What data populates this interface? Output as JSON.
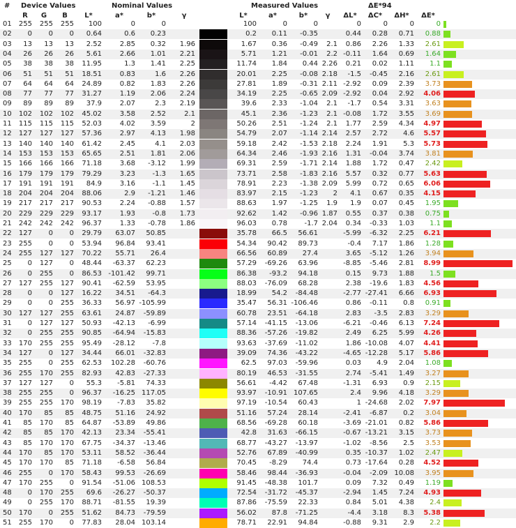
{
  "headers": {
    "group": {
      "num": "#",
      "device": "Device Values",
      "nominal": "Nominal Values",
      "measured": "Measured Values",
      "de94": "ΔE*94"
    },
    "columns": {
      "R": "R",
      "G": "G",
      "B": "B",
      "nL": "L*",
      "na": "a*",
      "nb": "b*",
      "ng": "γ",
      "mL": "L*",
      "ma": "a*",
      "mb": "b*",
      "mg": "γ",
      "dL": "ΔL*",
      "dC": "ΔC*",
      "dH": "ΔH*",
      "dE": "ΔE*"
    }
  },
  "colors": {
    "green_bar": "#7de020",
    "yellow_bar": "#c8f020",
    "orange_bar": "#e8921e",
    "red_bar": "#ee2222"
  },
  "rows": [
    {
      "n": "01",
      "R": "255",
      "G": "255",
      "B": "255",
      "nL": "100",
      "na": "0",
      "nb": "0",
      "ng": "",
      "mL": "100",
      "ma": "0",
      "mb": "0",
      "mg": "",
      "dL": "0",
      "dC": "0",
      "dH": "0",
      "dE": "0",
      "nom": "#ffffff",
      "meas": "#ffffff"
    },
    {
      "n": "02",
      "R": "0",
      "G": "0",
      "B": "0",
      "nL": "0.64",
      "na": "0.6",
      "nb": "0.23",
      "ng": "",
      "mL": "0.2",
      "ma": "0.11",
      "mb": "-0.35",
      "mg": "",
      "dL": "0.44",
      "dC": "0.28",
      "dH": "0.71",
      "dE": "0.88",
      "nom": "#020202",
      "meas": "#000000"
    },
    {
      "n": "03",
      "R": "13",
      "G": "13",
      "B": "13",
      "nL": "2.52",
      "na": "2.85",
      "nb": "0.32",
      "ng": "1.96",
      "mL": "1.67",
      "ma": "0.36",
      "mb": "-0.49",
      "mg": "2.1",
      "dL": "0.86",
      "dC": "2.26",
      "dH": "1.33",
      "dE": "2.61",
      "nom": "#0e0a0a",
      "meas": "#070606"
    },
    {
      "n": "04",
      "R": "26",
      "G": "26",
      "B": "26",
      "nL": "5.61",
      "na": "2.66",
      "nb": "1.01",
      "ng": "2.21",
      "mL": "5.71",
      "ma": "1.21",
      "mb": "-0.01",
      "mg": "2.2",
      "dL": "-0.11",
      "dC": "1.64",
      "dH": "0.69",
      "dE": "1.64",
      "nom": "#1a1416",
      "meas": "#141212"
    },
    {
      "n": "05",
      "R": "38",
      "G": "38",
      "B": "38",
      "nL": "11.95",
      "na": "1.3",
      "nb": "1.41",
      "ng": "2.25",
      "mL": "11.74",
      "ma": "1.84",
      "mb": "0.44",
      "mg": "2.26",
      "dL": "0.21",
      "dC": "0.02",
      "dH": "1.11",
      "dE": "1.1",
      "nom": "#232021",
      "meas": "#211f20"
    },
    {
      "n": "06",
      "R": "51",
      "G": "51",
      "B": "51",
      "nL": "18.51",
      "na": "0.83",
      "nb": "1.6",
      "ng": "2.26",
      "mL": "20.01",
      "ma": "2.25",
      "mb": "-0.08",
      "mg": "2.18",
      "dL": "-1.5",
      "dC": "-0.45",
      "dH": "2.16",
      "dE": "2.61",
      "nom": "#302d2d",
      "meas": "#332f31"
    },
    {
      "n": "07",
      "R": "64",
      "G": "64",
      "B": "64",
      "nL": "24.89",
      "na": "0.82",
      "nb": "1.83",
      "ng": "2.26",
      "mL": "27.81",
      "ma": "1.89",
      "mb": "-0.31",
      "mg": "2.11",
      "dL": "-2.92",
      "dC": "0.09",
      "dH": "2.39",
      "dE": "3.73",
      "nom": "#3c3a39",
      "meas": "#444244"
    },
    {
      "n": "08",
      "R": "77",
      "G": "77",
      "B": "77",
      "nL": "31.27",
      "na": "1.19",
      "nb": "2.06",
      "ng": "2.24",
      "mL": "34.19",
      "ma": "2.25",
      "mb": "-0.65",
      "mg": "2.09",
      "dL": "-2.92",
      "dC": "0.04",
      "dH": "2.92",
      "dE": "4.06",
      "nom": "#494747",
      "meas": "#525053"
    },
    {
      "n": "09",
      "R": "89",
      "G": "89",
      "B": "89",
      "nL": "37.9",
      "na": "2.07",
      "nb": "2.3",
      "ng": "2.19",
      "mL": "39.6",
      "ma": "2.33",
      "mb": "-1.04",
      "mg": "2.1",
      "dL": "-1.7",
      "dC": "0.54",
      "dH": "3.31",
      "dE": "3.63",
      "nom": "#595555",
      "meas": "#5f5c60"
    },
    {
      "n": "10",
      "R": "102",
      "G": "102",
      "B": "102",
      "nL": "45.02",
      "na": "3.58",
      "nb": "2.52",
      "ng": "2.1",
      "mL": "45.1",
      "ma": "2.36",
      "mb": "-1.23",
      "mg": "2.1",
      "dL": "-0.08",
      "dC": "1.72",
      "dH": "3.55",
      "dE": "3.69",
      "nom": "#6c6665",
      "meas": "#6d6a6f"
    },
    {
      "n": "11",
      "R": "115",
      "G": "115",
      "B": "115",
      "nL": "52.03",
      "na": "4.02",
      "nb": "3.59",
      "ng": "2",
      "mL": "50.26",
      "ma": "2.51",
      "mb": "-1.24",
      "mg": "2.1",
      "dL": "1.77",
      "dC": "2.59",
      "dH": "4.34",
      "dE": "4.97",
      "nom": "#7e7775",
      "meas": "#7a777c"
    },
    {
      "n": "12",
      "R": "127",
      "G": "127",
      "B": "127",
      "nL": "57.36",
      "na": "2.97",
      "nb": "4.13",
      "ng": "1.98",
      "mL": "54.79",
      "ma": "2.07",
      "mb": "-1.14",
      "mg": "2.14",
      "dL": "2.57",
      "dC": "2.72",
      "dH": "4.6",
      "dE": "5.57",
      "nom": "#8a8581",
      "meas": "#858287"
    },
    {
      "n": "13",
      "R": "140",
      "G": "140",
      "B": "140",
      "nL": "61.42",
      "na": "2.45",
      "nb": "4.1",
      "ng": "2.03",
      "mL": "59.18",
      "ma": "2.42",
      "mb": "-1.53",
      "mg": "2.18",
      "dL": "2.24",
      "dC": "1.91",
      "dH": "5.3",
      "dE": "5.73",
      "nom": "#958f8b",
      "meas": "#8f8c93"
    },
    {
      "n": "14",
      "R": "153",
      "G": "153",
      "B": "153",
      "nL": "65.65",
      "na": "2.51",
      "nb": "1.81",
      "ng": "2.06",
      "mL": "64.34",
      "ma": "2.46",
      "mb": "-1.93",
      "mg": "2.16",
      "dL": "1.31",
      "dC": "-0.04",
      "dH": "3.74",
      "dE": "3.81",
      "nom": "#a19b9a",
      "meas": "#9d9aa1"
    },
    {
      "n": "15",
      "R": "166",
      "G": "166",
      "B": "166",
      "nL": "71.18",
      "na": "3.68",
      "nb": "-3.12",
      "ng": "1.99",
      "mL": "69.31",
      "ma": "2.59",
      "mb": "-1.71",
      "mg": "2.14",
      "dL": "1.88",
      "dC": "1.72",
      "dH": "0.47",
      "dE": "2.42",
      "nom": "#b3adb6",
      "meas": "#aca9b0"
    },
    {
      "n": "16",
      "R": "179",
      "G": "179",
      "B": "179",
      "nL": "79.29",
      "na": "3.23",
      "nb": "-1.3",
      "ng": "1.65",
      "mL": "73.71",
      "ma": "2.58",
      "mb": "-1.83",
      "mg": "2.16",
      "dL": "5.57",
      "dC": "0.32",
      "dH": "0.77",
      "dE": "5.63",
      "nom": "#cbc5cb",
      "meas": "#b9b6bd"
    },
    {
      "n": "17",
      "R": "191",
      "G": "191",
      "B": "191",
      "nL": "84.9",
      "na": "3.16",
      "nb": "-1.1",
      "ng": "1.45",
      "mL": "78.91",
      "ma": "2.23",
      "mb": "-1.38",
      "mg": "2.09",
      "dL": "5.99",
      "dC": "0.72",
      "dH": "0.65",
      "dE": "6.06",
      "nom": "#dbd5da",
      "meas": "#c8c5cb"
    },
    {
      "n": "18",
      "R": "204",
      "G": "204",
      "B": "204",
      "nL": "88.06",
      "na": "2.9",
      "nb": "-1.21",
      "ng": "1.46",
      "mL": "83.97",
      "ma": "2.15",
      "mb": "-1.23",
      "mg": "2",
      "dL": "4.1",
      "dC": "0.67",
      "dH": "0.35",
      "dE": "4.15",
      "nom": "#e5dee4",
      "meas": "#d7d4da"
    },
    {
      "n": "19",
      "R": "217",
      "G": "217",
      "B": "217",
      "nL": "90.53",
      "na": "2.24",
      "nb": "-0.88",
      "ng": "1.57",
      "mL": "88.63",
      "ma": "1.97",
      "mb": "-1.25",
      "mg": "1.9",
      "dL": "1.9",
      "dC": "0.07",
      "dH": "0.45",
      "dE": "1.95",
      "nom": "#ebe6ea",
      "meas": "#e4e1e7"
    },
    {
      "n": "20",
      "R": "229",
      "G": "229",
      "B": "229",
      "nL": "93.17",
      "na": "1.93",
      "nb": "-0.8",
      "ng": "1.73",
      "mL": "92.62",
      "ma": "1.42",
      "mb": "-0.96",
      "mg": "1.87",
      "dL": "0.55",
      "dC": "0.37",
      "dH": "0.38",
      "dE": "0.75",
      "nom": "#f2eef1",
      "meas": "#efedf1"
    },
    {
      "n": "21",
      "R": "242",
      "G": "242",
      "B": "242",
      "nL": "96.37",
      "na": "1.33",
      "nb": "-0.78",
      "ng": "1.86",
      "mL": "96.03",
      "ma": "0.78",
      "mb": "-1.7",
      "mg": "2.04",
      "dL": "0.34",
      "dC": "-0.33",
      "dH": "1.03",
      "dE": "1.1",
      "nom": "#f9f6f9",
      "meas": "#f6f5fb"
    },
    {
      "n": "22",
      "R": "127",
      "G": "0",
      "B": "0",
      "nL": "29.79",
      "na": "63.07",
      "nb": "50.85",
      "ng": "",
      "mL": "35.78",
      "ma": "66.5",
      "mb": "56.61",
      "mg": "",
      "dL": "-5.99",
      "dC": "-6.32",
      "dH": "2.25",
      "dE": "6.21",
      "nom": "#8a0c0a",
      "meas": "#9e1a14"
    },
    {
      "n": "23",
      "R": "255",
      "G": "0",
      "B": "0",
      "nL": "53.94",
      "na": "96.84",
      "nb": "93.41",
      "ng": "",
      "mL": "54.34",
      "ma": "90.42",
      "mb": "89.73",
      "mg": "",
      "dL": "-0.4",
      "dC": "7.17",
      "dH": "1.86",
      "dE": "1.28",
      "nom": "#fb0006",
      "meas": "#f02018"
    },
    {
      "n": "24",
      "R": "255",
      "G": "127",
      "B": "127",
      "nL": "70.22",
      "na": "55.71",
      "nb": "26.4",
      "ng": "",
      "mL": "66.56",
      "ma": "60.89",
      "mb": "27.4",
      "mg": "",
      "dL": "3.65",
      "dC": "-5.12",
      "dH": "1.26",
      "dE": "3.94",
      "nom": "#f88480",
      "meas": "#ee6e6e"
    },
    {
      "n": "25",
      "R": "0",
      "G": "127",
      "B": "0",
      "nL": "48.44",
      "na": "-63.37",
      "nb": "62.23",
      "ng": "",
      "mL": "57.29",
      "ma": "-69.26",
      "mb": "63.96",
      "mg": "",
      "dL": "-8.85",
      "dC": "-5.46",
      "dH": "2.81",
      "dE": "8.99",
      "nom": "#1e8a0e",
      "meas": "#2aa616"
    },
    {
      "n": "26",
      "R": "0",
      "G": "255",
      "B": "0",
      "nL": "86.53",
      "na": "-101.42",
      "nb": "99.71",
      "ng": "",
      "mL": "86.38",
      "ma": "-93.2",
      "mb": "94.18",
      "mg": "",
      "dL": "0.15",
      "dC": "9.73",
      "dH": "1.88",
      "dE": "1.5",
      "nom": "#06ff18",
      "meas": "#4aff30"
    },
    {
      "n": "27",
      "R": "127",
      "G": "255",
      "B": "127",
      "nL": "90.41",
      "na": "-62.59",
      "nb": "53.95",
      "ng": "",
      "mL": "88.03",
      "ma": "-76.09",
      "mb": "68.28",
      "mg": "",
      "dL": "2.38",
      "dC": "-19.6",
      "dH": "1.83",
      "dE": "4.56",
      "nom": "#8cff80",
      "meas": "#6aff40"
    },
    {
      "n": "28",
      "R": "0",
      "G": "0",
      "B": "127",
      "nL": "16.22",
      "na": "34.51",
      "nb": "-64.3",
      "ng": "",
      "mL": "18.99",
      "ma": "54.2",
      "mb": "-84.48",
      "mg": "",
      "dL": "-2.77",
      "dC": "-27.41",
      "dH": "6.66",
      "dE": "6.93",
      "nom": "#181a8e",
      "meas": "#2a0aa6"
    },
    {
      "n": "29",
      "R": "0",
      "G": "0",
      "B": "255",
      "nL": "36.33",
      "na": "56.97",
      "nb": "-105.99",
      "ng": "",
      "mL": "35.47",
      "ma": "56.31",
      "mb": "-106.46",
      "mg": "",
      "dL": "0.86",
      "dC": "-0.11",
      "dH": "0.8",
      "dE": "0.91",
      "nom": "#2a2aff",
      "meas": "#2626ff"
    },
    {
      "n": "30",
      "R": "127",
      "G": "127",
      "B": "255",
      "nL": "63.61",
      "na": "24.87",
      "nb": "-59.89",
      "ng": "",
      "mL": "60.78",
      "ma": "23.51",
      "mb": "-64.18",
      "mg": "",
      "dL": "2.83",
      "dC": "-3.5",
      "dH": "2.83",
      "dE": "3.29",
      "nom": "#8c90ff",
      "meas": "#8084ff"
    },
    {
      "n": "31",
      "R": "0",
      "G": "127",
      "B": "127",
      "nL": "50.93",
      "na": "-42.13",
      "nb": "-6.99",
      "ng": "",
      "mL": "57.14",
      "ma": "-41.15",
      "mb": "-13.06",
      "mg": "",
      "dL": "-6.21",
      "dC": "-0.46",
      "dH": "6.13",
      "dE": "7.24",
      "nom": "#158a86",
      "meas": "#14a0aa"
    },
    {
      "n": "32",
      "R": "0",
      "G": "255",
      "B": "255",
      "nL": "90.85",
      "na": "-64.94",
      "nb": "-15.83",
      "ng": "",
      "mL": "88.36",
      "ma": "-57.26",
      "mb": "-19.82",
      "mg": "",
      "dL": "2.49",
      "dC": "6.25",
      "dH": "5.99",
      "dE": "4.26",
      "nom": "#20fff6",
      "meas": "#3af8ff"
    },
    {
      "n": "33",
      "R": "170",
      "G": "255",
      "B": "255",
      "nL": "95.49",
      "na": "-28.12",
      "nb": "-7.8",
      "ng": "",
      "mL": "93.63",
      "ma": "-37.69",
      "mb": "-11.02",
      "mg": "",
      "dL": "1.86",
      "dC": "-10.08",
      "dH": "4.07",
      "dE": "4.41",
      "nom": "#b4fffc",
      "meas": "#a2fcff"
    },
    {
      "n": "34",
      "R": "127",
      "G": "0",
      "B": "127",
      "nL": "34.44",
      "na": "66.01",
      "nb": "-32.83",
      "ng": "",
      "mL": "39.09",
      "ma": "74.36",
      "mb": "-43.22",
      "mg": "",
      "dL": "-4.65",
      "dC": "-12.28",
      "dH": "5.17",
      "dE": "5.86",
      "nom": "#8e1a82",
      "meas": "#a214aa"
    },
    {
      "n": "35",
      "R": "255",
      "G": "0",
      "B": "255",
      "nL": "62.53",
      "na": "102.28",
      "nb": "-60.76",
      "ng": "",
      "mL": "62.5",
      "ma": "97.03",
      "mb": "-59.96",
      "mg": "",
      "dL": "0.03",
      "dC": "4.9",
      "dH": "2.04",
      "dE": "1.08",
      "nom": "#ff16ff",
      "meas": "#f624f8"
    },
    {
      "n": "36",
      "R": "255",
      "G": "170",
      "B": "255",
      "nL": "82.93",
      "na": "42.83",
      "nb": "-27.33",
      "ng": "",
      "mL": "80.19",
      "ma": "46.53",
      "mb": "-31.55",
      "mg": "",
      "dL": "2.74",
      "dC": "-5.41",
      "dH": "1.49",
      "dE": "3.27",
      "nom": "#ffb2ff",
      "meas": "#ffa6ff"
    },
    {
      "n": "37",
      "R": "127",
      "G": "127",
      "B": "0",
      "nL": "55.3",
      "na": "-5.81",
      "nb": "74.33",
      "ng": "",
      "mL": "56.61",
      "ma": "-4.42",
      "mb": "67.48",
      "mg": "",
      "dL": "-1.31",
      "dC": "6.93",
      "dH": "0.9",
      "dE": "2.15",
      "nom": "#8c8800",
      "meas": "#8e8812"
    },
    {
      "n": "38",
      "R": "255",
      "G": "255",
      "B": "0",
      "nL": "96.37",
      "na": "-16.25",
      "nb": "117.05",
      "ng": "",
      "mL": "93.97",
      "ma": "-10.91",
      "mb": "107.65",
      "mg": "",
      "dL": "2.4",
      "dC": "9.96",
      "dH": "4.18",
      "dE": "3.29",
      "nom": "#fffc00",
      "meas": "#fff012"
    },
    {
      "n": "39",
      "R": "255",
      "G": "255",
      "B": "170",
      "nL": "98.19",
      "na": "-7.83",
      "nb": "35.82",
      "ng": "",
      "mL": "97.19",
      "ma": "-10.54",
      "mb": "60.43",
      "mg": "",
      "dL": "1",
      "dC": "-24.68",
      "dH": "2.02",
      "dE": "7.97",
      "nom": "#fffdb0",
      "meas": "#fffa70"
    },
    {
      "n": "40",
      "R": "170",
      "G": "85",
      "B": "85",
      "nL": "48.75",
      "na": "51.16",
      "nb": "24.92",
      "ng": "",
      "mL": "51.16",
      "ma": "57.24",
      "mb": "28.14",
      "mg": "",
      "dL": "-2.41",
      "dC": "-6.87",
      "dH": "0.2",
      "dE": "3.04",
      "nom": "#b04a4a",
      "meas": "#bc4646"
    },
    {
      "n": "41",
      "R": "85",
      "G": "170",
      "B": "85",
      "nL": "64.87",
      "na": "-53.89",
      "nb": "49.86",
      "ng": "",
      "mL": "68.56",
      "ma": "-69.28",
      "mb": "60.18",
      "mg": "",
      "dL": "-3.69",
      "dC": "-21.01",
      "dH": "0.82",
      "dE": "5.86",
      "nom": "#4eb24a",
      "meas": "#3cc030"
    },
    {
      "n": "42",
      "R": "85",
      "G": "85",
      "B": "170",
      "nL": "42.13",
      "na": "23.34",
      "nb": "-55.41",
      "ng": "",
      "mL": "42.8",
      "ma": "31.63",
      "mb": "-66.15",
      "mg": "",
      "dL": "-0.67",
      "dC": "-13.21",
      "dH": "3.15",
      "dE": "3.73",
      "nom": "#4e5cb4",
      "meas": "#4a58c6"
    },
    {
      "n": "43",
      "R": "85",
      "G": "170",
      "B": "170",
      "nL": "67.75",
      "na": "-34.37",
      "nb": "-13.46",
      "ng": "",
      "mL": "68.77",
      "ma": "-43.27",
      "mb": "-13.97",
      "mg": "",
      "dL": "-1.02",
      "dC": "-8.56",
      "dH": "2.5",
      "dE": "3.53",
      "nom": "#52b8b6",
      "meas": "#3ec0c0"
    },
    {
      "n": "44",
      "R": "170",
      "G": "85",
      "B": "170",
      "nL": "53.11",
      "na": "58.52",
      "nb": "-36.44",
      "ng": "",
      "mL": "52.76",
      "ma": "67.89",
      "mb": "-40.99",
      "mg": "",
      "dL": "0.35",
      "dC": "-10.37",
      "dH": "1.02",
      "dE": "2.47",
      "nom": "#b44ab2",
      "meas": "#bc3cbe"
    },
    {
      "n": "45",
      "R": "170",
      "G": "170",
      "B": "85",
      "nL": "71.18",
      "na": "-6.58",
      "nb": "56.84",
      "ng": "",
      "mL": "70.45",
      "ma": "-8.29",
      "mb": "74.4",
      "mg": "",
      "dL": "0.73",
      "dC": "-17.64",
      "dH": "0.28",
      "dE": "4.52",
      "nom": "#b0ac4c",
      "meas": "#b0aa20"
    },
    {
      "n": "46",
      "R": "255",
      "G": "0",
      "B": "170",
      "nL": "58.43",
      "na": "99.53",
      "nb": "-26.69",
      "ng": "",
      "mL": "58.46",
      "ma": "98.44",
      "mb": "-36.93",
      "mg": "",
      "dL": "-0.04",
      "dC": "-2.09",
      "dH": "10.08",
      "dE": "3.95",
      "nom": "#ff00b0",
      "meas": "#f800c8"
    },
    {
      "n": "47",
      "R": "170",
      "G": "255",
      "B": "0",
      "nL": "91.54",
      "na": "-51.06",
      "nb": "108.53",
      "ng": "",
      "mL": "91.45",
      "ma": "-48.38",
      "mb": "101.7",
      "mg": "",
      "dL": "0.09",
      "dC": "7.32",
      "dH": "0.49",
      "dE": "1.19",
      "nom": "#b0ff00",
      "meas": "#b8ff10"
    },
    {
      "n": "48",
      "R": "0",
      "G": "170",
      "B": "255",
      "nL": "69.6",
      "na": "-26.27",
      "nb": "-50.37",
      "ng": "",
      "mL": "72.54",
      "ma": "-31.72",
      "mb": "-45.37",
      "mg": "",
      "dL": "-2.94",
      "dC": "1.45",
      "dH": "7.24",
      "dE": "4.93",
      "nom": "#00acff",
      "meas": "#12c0f8"
    },
    {
      "n": "49",
      "R": "0",
      "G": "255",
      "B": "170",
      "nL": "88.71",
      "na": "-81.55",
      "nb": "19.39",
      "ng": "",
      "mL": "87.86",
      "ma": "-75.59",
      "mb": "22.33",
      "mg": "",
      "dL": "0.84",
      "dC": "5.01",
      "dH": "4.38",
      "dE": "2.4",
      "nom": "#00ffb4",
      "meas": "#2cffa8"
    },
    {
      "n": "50",
      "R": "170",
      "G": "0",
      "B": "255",
      "nL": "51.62",
      "na": "84.73",
      "nb": "-79.59",
      "ng": "",
      "mL": "56.02",
      "ma": "87.8",
      "mb": "-71.25",
      "mg": "",
      "dL": "-4.4",
      "dC": "3.18",
      "dH": "8.3",
      "dE": "5.38",
      "nom": "#ac1aff",
      "meas": "#c038f8"
    },
    {
      "n": "51",
      "R": "255",
      "G": "170",
      "B": "0",
      "nL": "77.83",
      "na": "28.04",
      "nb": "103.14",
      "ng": "",
      "mL": "78.71",
      "ma": "22.91",
      "mb": "94.84",
      "mg": "",
      "dL": "-0.88",
      "dC": "9.31",
      "dH": "2.9",
      "dE": "2.2",
      "nom": "#ffac00",
      "meas": "#f4ae1a"
    }
  ]
}
